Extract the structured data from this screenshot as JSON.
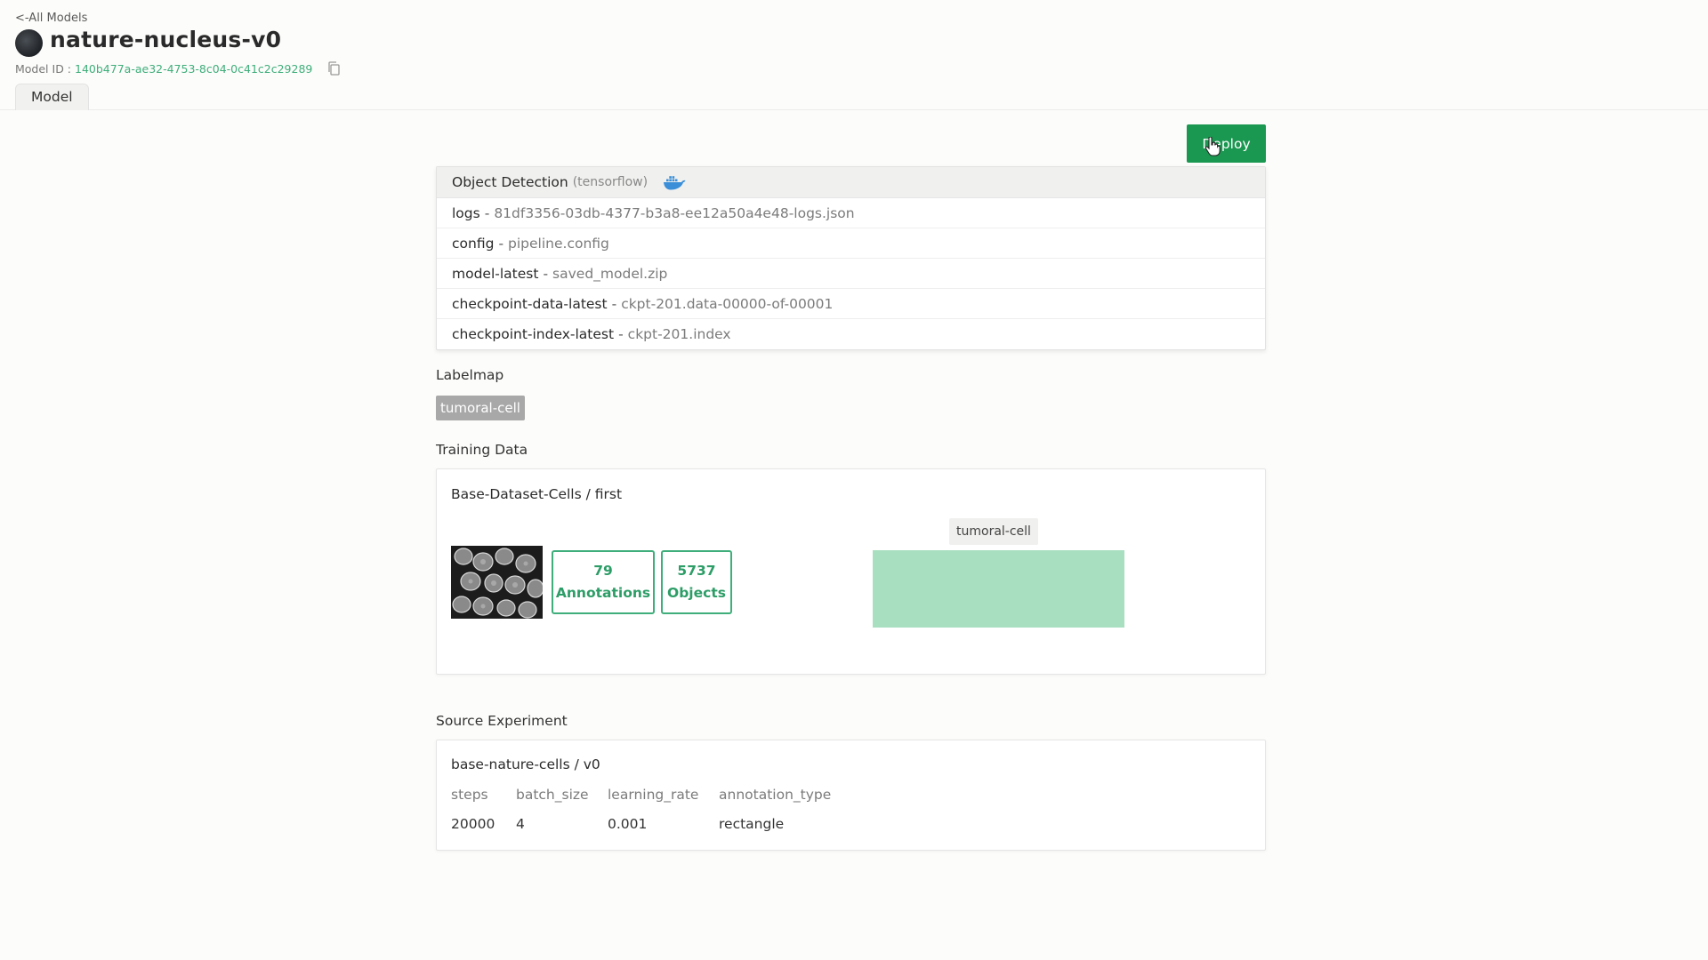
{
  "header": {
    "back_link": "<-All Models",
    "title": "nature-nucleus-v0",
    "model_id_label": "Model ID :",
    "model_id_value": "140b477a-ae32-4753-8c04-0c41c2c29289",
    "tab_label": "Model"
  },
  "deploy_label": "Deploy",
  "files": {
    "task": "Object Detection",
    "framework": "(tensorflow)",
    "rows": [
      {
        "key": "logs",
        "file": "81df3356-03db-4377-b3a8-ee12a50a4e48-logs.json"
      },
      {
        "key": "config",
        "file": "pipeline.config"
      },
      {
        "key": "model-latest",
        "file": "saved_model.zip"
      },
      {
        "key": "checkpoint-data-latest",
        "file": "ckpt-201.data-00000-of-00001"
      },
      {
        "key": "checkpoint-index-latest",
        "file": "ckpt-201.index"
      }
    ],
    "separator": "-"
  },
  "labelmap": {
    "title": "Labelmap",
    "labels": [
      "tumoral-cell"
    ]
  },
  "training_data": {
    "title": "Training Data",
    "dataset": "Base-Dataset-Cells / first",
    "annotations_count": "79",
    "annotations_label": "Annotations",
    "objects_count": "5737",
    "objects_label": "Objects"
  },
  "chart_data": {
    "type": "bar",
    "categories": [
      "tumoral-cell"
    ],
    "values": [
      5737
    ],
    "color": "#a8dfc0",
    "title": "",
    "xlabel": "",
    "ylabel": ""
  },
  "source_experiment": {
    "title": "Source Experiment",
    "name": "base-nature-cells / v0",
    "headers": [
      "steps",
      "batch_size",
      "learning_rate",
      "annotation_type"
    ],
    "values": [
      "20000",
      "4",
      "0.001",
      "rectangle"
    ]
  },
  "colors": {
    "accent": "#3fae7b",
    "deploy": "#1a9750"
  }
}
